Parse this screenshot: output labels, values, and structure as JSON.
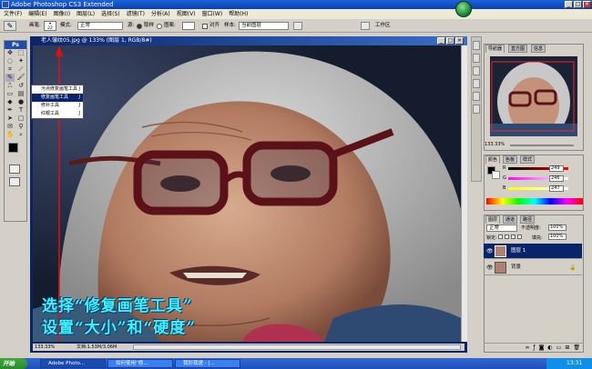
{
  "window": {
    "title": "Adobe Photoshop CS3 Extended"
  },
  "menu": [
    "文件(F)",
    "编辑(E)",
    "图像(I)",
    "图层(L)",
    "选择(S)",
    "滤镜(T)",
    "分析(A)",
    "视图(V)",
    "窗口(W)",
    "帮助(H)"
  ],
  "options": {
    "brush_label": "画笔:",
    "brush_size": "22",
    "mode_label": "模式:",
    "mode_value": "正常",
    "source_label": "源:",
    "sampled_label": "取样",
    "pattern_label": "图案:",
    "aligned_label": "对齐",
    "sample_label": "样本:",
    "sample_value": "当前图层",
    "workspace_label": "工作区"
  },
  "document": {
    "title": "老人皱纹05.jpg @ 133% (图层 1, RGB/8#)",
    "zoom": "133.33%",
    "docinfo": "文档:1.53M/3.06M"
  },
  "tool_flyout": [
    {
      "label": "污点修复画笔工具",
      "key": "J",
      "selected": false
    },
    {
      "label": "修复画笔工具",
      "key": "J",
      "selected": true
    },
    {
      "label": "修补工具",
      "key": "J",
      "selected": false
    },
    {
      "label": "红眼工具",
      "key": "J",
      "selected": false
    }
  ],
  "caption": {
    "line1": "选择“修复画笔工具”",
    "line2": "设置“大小”和“硬度”"
  },
  "navigator": {
    "tabs": [
      "导航器",
      "直方图",
      "信息"
    ],
    "zoom": "133.33%"
  },
  "color_panel": {
    "tabs": [
      "颜色",
      "色板",
      "样式"
    ],
    "channels": [
      {
        "name": "R",
        "value": "249"
      },
      {
        "name": "G",
        "value": "246"
      },
      {
        "name": "B",
        "value": "247"
      }
    ]
  },
  "layers_panel": {
    "tabs": [
      "图层",
      "通道",
      "路径"
    ],
    "blend_mode": "正常",
    "opacity_label": "不透明度:",
    "opacity": "100%",
    "lock_label": "锁定:",
    "fill_label": "填充:",
    "fill": "100%",
    "layers": [
      {
        "name": "图层 1",
        "selected": true
      },
      {
        "name": "背景",
        "selected": false
      }
    ]
  },
  "taskbar": {
    "start": "开始",
    "tasks": [
      "Adobe Photo...",
      "如何使用“修...",
      "我形我速 - [..."
    ],
    "clock": "13:31"
  },
  "colors": {
    "accent": "#0a246a",
    "caption": "#3cf4ff",
    "arrow": "#e01010"
  }
}
